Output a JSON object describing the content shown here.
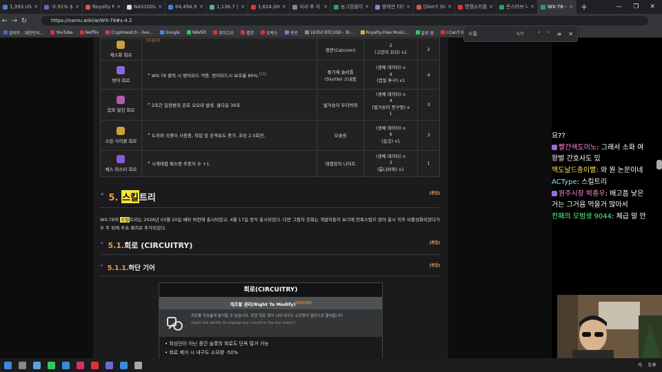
{
  "tabs": [
    {
      "label": "1,393 US",
      "color": "#4a7fd6"
    },
    {
      "label": "-0.91% $4",
      "color": "#7e57c2"
    },
    {
      "label": "Royalty Fre",
      "color": "#e05050"
    },
    {
      "label": "NAS100USD",
      "color": "#ddd"
    },
    {
      "label": "64,494.9 |",
      "color": "#4a7fd6"
    },
    {
      "label": "1,136.7 | SK",
      "color": "#4ab0a0"
    },
    {
      "label": "1,624,000원",
      "color": "#e03040"
    },
    {
      "label": "식사 후 지",
      "color": "#888"
    },
    {
      "label": "농그멍꿈이",
      "color": "#2e9e5a"
    },
    {
      "label": "왕의만 타더",
      "color": "#9b7bd9"
    },
    {
      "label": "[Don't Sta",
      "color": "#e05050"
    },
    {
      "label": "명쟁소리를",
      "color": "#e03040"
    },
    {
      "label": "돈스타브 나",
      "color": "#2e9e5a"
    },
    {
      "label": "WX-78 - 나",
      "color": "#2e9e5a",
      "active": true
    }
  ],
  "newtab": "+",
  "window": {
    "min": "—",
    "max": "❐",
    "close": "✕"
  },
  "address": {
    "back": "←",
    "forward": "→",
    "reload": "↻",
    "url": "https://namu.wiki/w/WX-78#s-4.2"
  },
  "find": {
    "query": "스킬",
    "count": "4/9",
    "prev": "˄",
    "next": "˅",
    "menu": "≡",
    "close": "✕"
  },
  "bookmarks": [
    {
      "label": "업비트 - 대한민국...",
      "color": "#3a6ad6"
    },
    {
      "label": "YouTube",
      "color": "#e03030"
    },
    {
      "label": "Netflix",
      "color": "#e03030"
    },
    {
      "label": "Cryptowatch - live...",
      "color": "#d6306a"
    },
    {
      "label": "Google",
      "color": "#4a8ae0"
    },
    {
      "label": "NAVER",
      "color": "#2ec95a"
    },
    {
      "label": "위믹고수",
      "color": "#e03030"
    },
    {
      "label": "캡코",
      "color": "#d03a3a"
    },
    {
      "label": "도박스",
      "color": "#e03030"
    },
    {
      "label": "쿠르",
      "color": "#9b6bd9"
    },
    {
      "label": "16350 BTCUSD - Bi...",
      "color": "#888"
    },
    {
      "label": "Royalty-Free Music...",
      "color": "#d6b03a"
    },
    {
      "label": "알로 꿈",
      "color": "#2ec95a"
    },
    {
      "label": "I Can't Beat Airma...",
      "color": "#e03030"
    }
  ],
  "skills": {
    "top_ref": "[21][22]",
    "rows": [
      {
        "name": "제소화 회로",
        "desc": "",
        "ref": "",
        "creature": "캣쿤(Catcoon)",
        "cost_lines": [
          "2",
          "(고양이 꼬리) x1"
        ],
        "num": "2",
        "color": "#c9a03a"
      },
      {
        "name": "방어 회로",
        "desc": "WX-78 클릭 시 방어모드 적용. 방어모드시 보호율 80%.",
        "ref": "[23]",
        "creature": "돌가재 슬러틀(Slurtle) 스내듬",
        "cost_lines": [
          "(생체 데이터) x",
          "4",
          "(껍질 투구) x1"
        ],
        "num": "4",
        "color": "#8a6ad6"
      },
      {
        "name": "음파 발진 회로",
        "desc": "2초간 일정범위 공포 오오라 발생. 쿨다운 30초",
        "ref": "",
        "creature": "벌거숭이 두더박쥐",
        "cost_lines": [
          "(생체 데이터) x",
          "4",
          "(벌거숭이 뭇구렁) x",
          "1"
        ],
        "num": "3",
        "color": "#b05ab0"
      },
      {
        "name": "스핀 사이클 회로",
        "desc": "도끼와 곡괭이 사용중, 작업 및 공격속도 증가. 초당 2.5회전.",
        "ref": "",
        "creature": "모슬링",
        "cost_lines": [
          "(생체 데이터) x",
          "6",
          "(솜깃) x1"
        ],
        "num": "3",
        "color": "#c9a03a"
      },
      {
        "name": "체스 마스터 회로",
        "desc": "시계태엽 체스병 추종자 수 +1.",
        "ref": "",
        "creature": "태엽장치 나이트",
        "cost_lines": [
          "(생체 데이터) x",
          "3",
          "(톱니바퀴) x1"
        ],
        "num": "1",
        "color": "#8a5ad6"
      }
    ]
  },
  "section5": {
    "num": "5.",
    "pre": "",
    "hl": "스킬",
    "post": " 트리",
    "edit": "[편집]"
  },
  "para": {
    "pre": "WX-78의 ",
    "hl": "스킬",
    "post": "트리는 2026년 03월 20일 베타 버전에 출시되었고, 4월 17일 정식 출시되었다. 다만 그림자 친화는 개발자들이 보기에 만족스럽지 않아 출시 직후 비활성화되었다가 수 주 뒤에 후속 패치로 추가되었다."
  },
  "section51": {
    "num": "5.1.",
    "title": " 회로 (CIRCUITRY)",
    "edit": "[편집]"
  },
  "section511": {
    "num": "5.1.1.",
    "title": " 하단 기어",
    "edit": "[편집]"
  },
  "box": {
    "title": "회로(CIRCUITRY)",
    "subtitle": "개조할 권리(Right To Modify)",
    "sub_ref": "[24][25]",
    "desc_ko": "회로를 자유롭게 탈거할 수 있습니다. 또한 회로 제거 시의 내구도 소모량이 절반으로 줄어듭니다",
    "desc_en": "(Gain the ability to unplug any circuit in the bar stack.)",
    "bullets": [
      "최상단이 아닌 중간 슬롯의 회로도 단독 탈거 가능",
      "회로 제거 시 내구도 소모량 -50%"
    ]
  },
  "chat": [
    {
      "user": "",
      "msg": "요??",
      "color": ""
    },
    {
      "user": "빨간색도미노",
      "msg": ": 그래서 소화 여",
      "color": "u-pink",
      "badge": true
    },
    {
      "user": "",
      "msg": "왕벌 간호사도 있",
      "color": ""
    },
    {
      "user": "맥도날드종이빨",
      "msg": ": 와 뭔 논문이네",
      "color": "u-yellow"
    },
    {
      "user": "ACType",
      "msg": ": 스킬트리",
      "color": "u-cyan"
    },
    {
      "user": "원주시장 박종우",
      "msg": ": 배고픔 낮은",
      "color": "u-pink",
      "badge": true
    },
    {
      "user": "",
      "msg": "거는 그거음 먹을거 많아서",
      "color": ""
    },
    {
      "user": "전패의 모범생 9044",
      "msg": ": 체급 말 안",
      "color": "u-green"
    }
  ],
  "taskbar": {
    "icons": [
      "#3a8ae0",
      "#888",
      "#5aa0e0",
      "#2ec95a",
      "#3a8ae0",
      "#d6306a",
      "#e03030",
      "#6a6ad6",
      "#3a8ae0",
      "#aaa"
    ]
  },
  "tray": {
    "ime": "가",
    "clock": "오후"
  },
  "colors": {
    "accent": "#e8a050",
    "highlight": "#f5e342"
  }
}
